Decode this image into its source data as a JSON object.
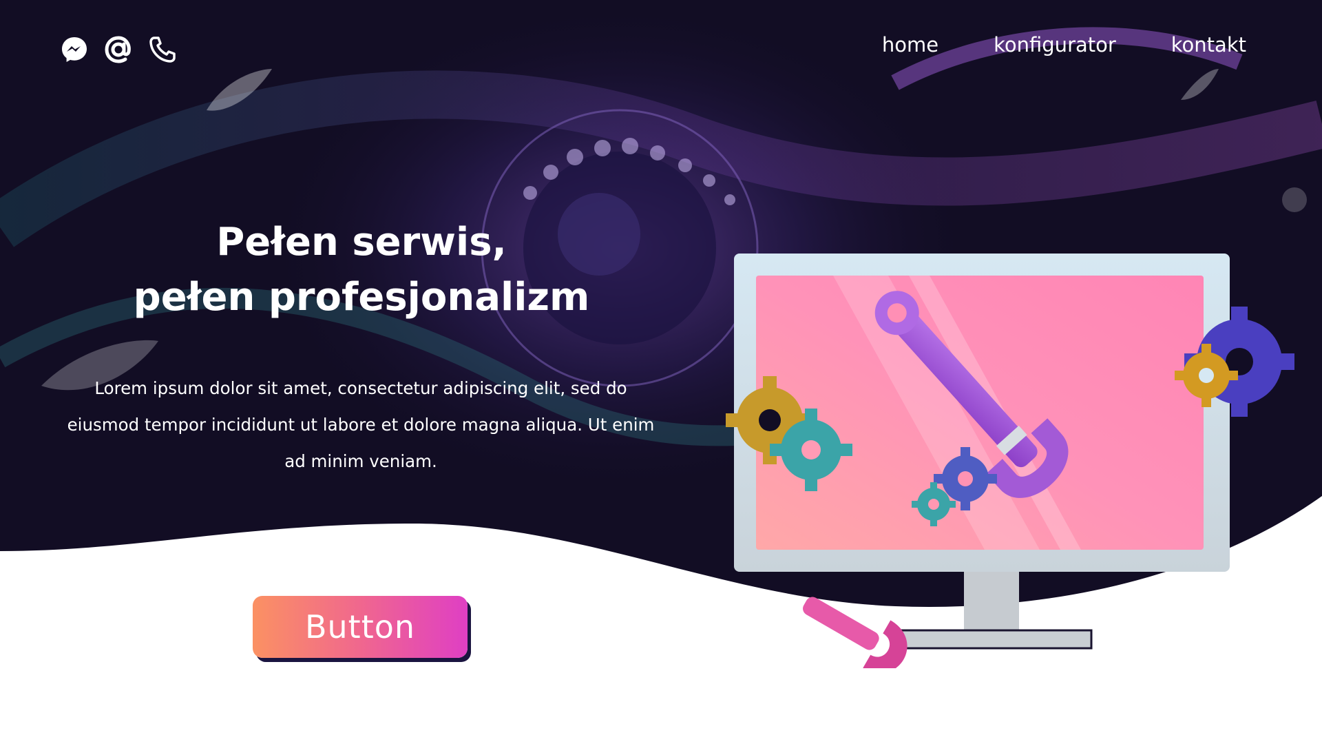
{
  "social": [
    {
      "name": "messenger-icon"
    },
    {
      "name": "email-at-icon"
    },
    {
      "name": "phone-icon"
    }
  ],
  "nav": {
    "items": [
      {
        "label": "home"
      },
      {
        "label": "konfigurator"
      },
      {
        "label": "kontakt"
      }
    ]
  },
  "hero": {
    "title_line1": "Pełen serwis,",
    "title_line2": "pełen profesjonalizm",
    "lead": "Lorem ipsum dolor sit amet, consectetur adipiscing elit, sed do eiusmod tempor incididunt ut labore et dolore magna aliqua. Ut enim ad minim veniam.",
    "cta_label": "Button"
  },
  "colors": {
    "hero_background": "#120d24",
    "accent_purple": "#8a3fd1",
    "screen_pink": "#ff8fb0",
    "button_gradient_start": "#fb9163",
    "button_gradient_end": "#df3fc4"
  }
}
